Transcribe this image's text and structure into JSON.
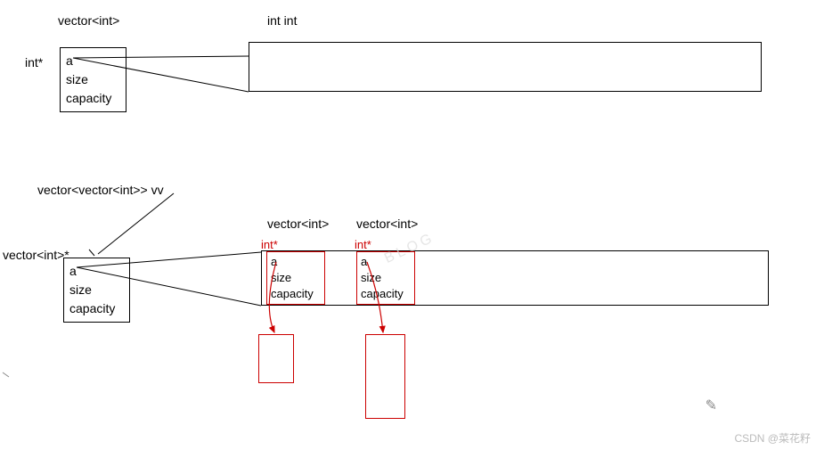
{
  "section1": {
    "title": "vector<int>",
    "elem_label": "int  int",
    "ptr_label": "int*",
    "fields": {
      "a": "a",
      "size": "size",
      "capacity": "capacity"
    }
  },
  "section2": {
    "title": "vector<vector<int>>  vv",
    "ptr_label": "vector<int>*",
    "outer_fields": {
      "a": "a",
      "size": "size",
      "capacity": "capacity"
    },
    "inner_label_1": "vector<int>",
    "inner_label_2": "vector<int>",
    "inner_ptr_label": "int*",
    "inner_fields": {
      "a": "a",
      "size": "size",
      "capacity": "capacity"
    }
  },
  "watermark": "BLOG",
  "footer": "CSDN @菜花籽"
}
